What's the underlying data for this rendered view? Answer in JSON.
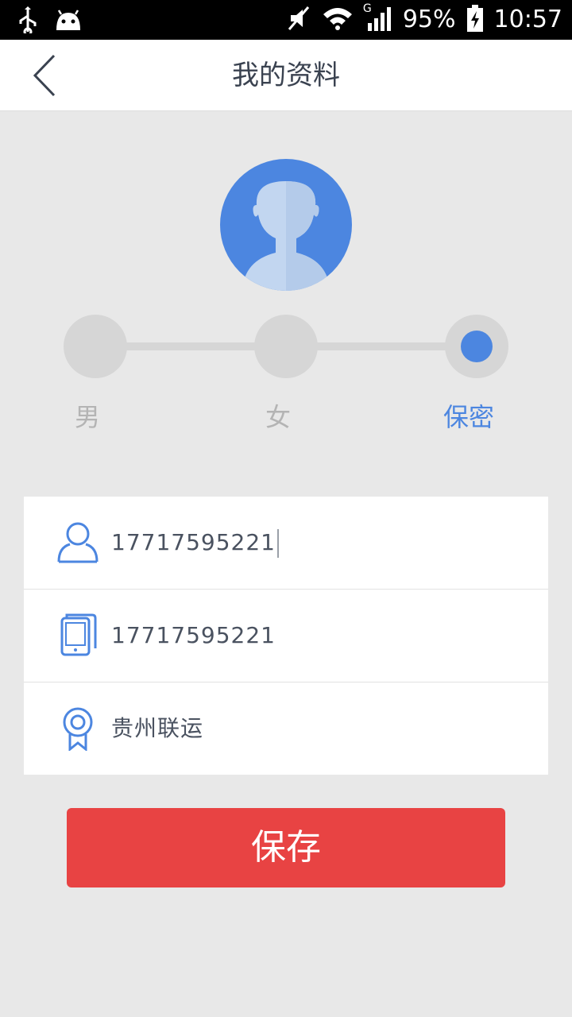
{
  "status_bar": {
    "battery": "95%",
    "time": "10:57",
    "network_type": "G",
    "icons": [
      "usb-icon",
      "android-icon",
      "mute-icon",
      "wifi-icon",
      "signal-icon",
      "battery-charging-icon"
    ]
  },
  "header": {
    "title": "我的资料",
    "back_icon": "chevron-left-icon"
  },
  "avatar": {
    "icon": "default-user-avatar",
    "color": "#4c86e0"
  },
  "gender": {
    "options": [
      {
        "label": "男",
        "selected": false
      },
      {
        "label": "女",
        "selected": false
      },
      {
        "label": "保密",
        "selected": true
      }
    ],
    "accent_color": "#4c86e0",
    "inactive_color": "#d6d6d6"
  },
  "form": {
    "fields": [
      {
        "icon": "user-icon",
        "value": "17717595221"
      },
      {
        "icon": "phone-icon",
        "value": "17717595221"
      },
      {
        "icon": "badge-icon",
        "value": "贵州联运"
      }
    ]
  },
  "actions": {
    "save_label": "保存",
    "save_color": "#e84343"
  }
}
